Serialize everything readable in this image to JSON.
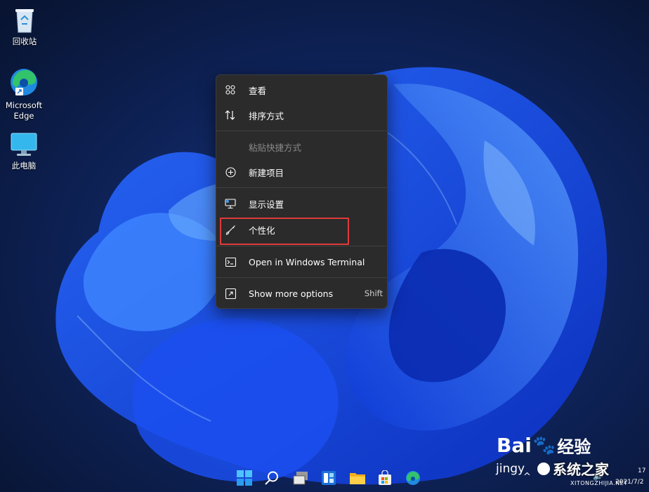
{
  "desktop": {
    "icons": [
      {
        "label": "回收站"
      },
      {
        "label": "Microsoft\nEdge"
      },
      {
        "label": "此电脑"
      }
    ]
  },
  "context_menu": {
    "items": [
      {
        "label": "查看",
        "icon": "grid-icon",
        "enabled": true
      },
      {
        "label": "排序方式",
        "icon": "sort-icon",
        "enabled": true
      },
      {
        "label": "粘贴快捷方式",
        "icon": "none",
        "enabled": false
      },
      {
        "label": "新建项目",
        "icon": "plus-circle-icon",
        "enabled": true
      },
      {
        "label": "显示设置",
        "icon": "display-icon",
        "enabled": true
      },
      {
        "label": "个性化",
        "icon": "brush-icon",
        "enabled": true
      },
      {
        "label": "Open in Windows Terminal",
        "icon": "terminal-icon",
        "enabled": true
      },
      {
        "label": "Show more options",
        "icon": "share-icon",
        "enabled": true,
        "shortcut": "Shift"
      }
    ]
  },
  "highlight": {
    "color": "#e03a3a",
    "target": "个性化"
  },
  "taskbar": {
    "icons": [
      "start-icon",
      "search-icon",
      "task-view-icon",
      "widgets-icon",
      "file-explorer-icon",
      "store-icon",
      "edge-icon"
    ]
  },
  "tray": {
    "time": "17",
    "date": "2021/7/2"
  },
  "watermarks": {
    "baidu": "Bai",
    "baidu_jingyan": "经验",
    "baidu_url": "jingy",
    "site_name": "系统之家",
    "site_url": "XITONGZHIJIA.NET"
  },
  "colors": {
    "menu_bg": "#2b2b2b",
    "accent": "#1a57ff"
  }
}
